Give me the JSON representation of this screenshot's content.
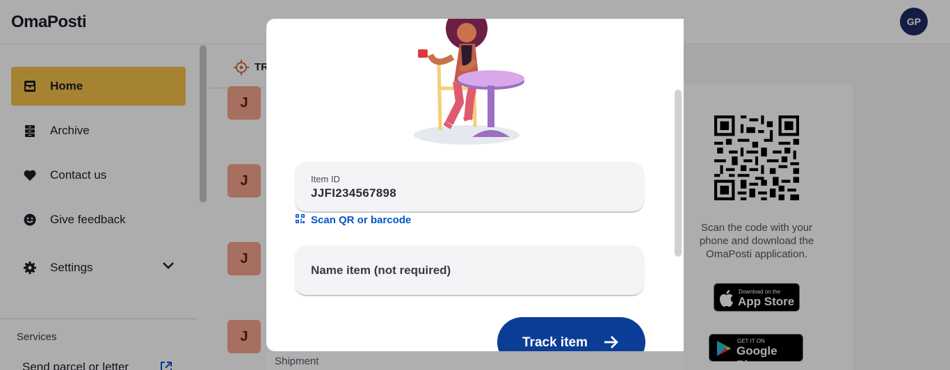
{
  "header": {
    "logo": "OmaPosti",
    "avatar_initials": "GP"
  },
  "sidebar": {
    "items": [
      {
        "label": "Home",
        "icon": "inbox-icon",
        "active": true
      },
      {
        "label": "Archive",
        "icon": "archive-icon",
        "active": false
      },
      {
        "label": "Contact us",
        "icon": "heart-icon",
        "active": false
      },
      {
        "label": "Give feedback",
        "icon": "smiley-icon",
        "active": false
      },
      {
        "label": "Settings",
        "icon": "gear-icon",
        "active": false
      }
    ],
    "services_label": "Services",
    "send_link": "Send parcel or letter"
  },
  "main": {
    "tab_label": "TR",
    "badges": [
      "J",
      "J",
      "J",
      "J"
    ],
    "shipment_label": "Shipment",
    "qr_text": "Scan the code with your phone and download the OmaPosti application.",
    "appstore": {
      "small": "Download on the",
      "big": "App Store"
    },
    "googleplay": {
      "small": "GET IT ON",
      "big": "Google Play"
    }
  },
  "modal": {
    "item_id_label": "Item ID",
    "item_id_value": "JJFI234567898",
    "scan_link": "Scan QR or barcode",
    "name_placeholder": "Name item (not required)",
    "track_button": "Track item"
  },
  "colors": {
    "accent_yellow": "#f3c14a",
    "primary_blue": "#0b3d96",
    "link_blue": "#0055c8",
    "badge_salmon": "#f5a48c",
    "avatar_navy": "#1c2a63"
  }
}
